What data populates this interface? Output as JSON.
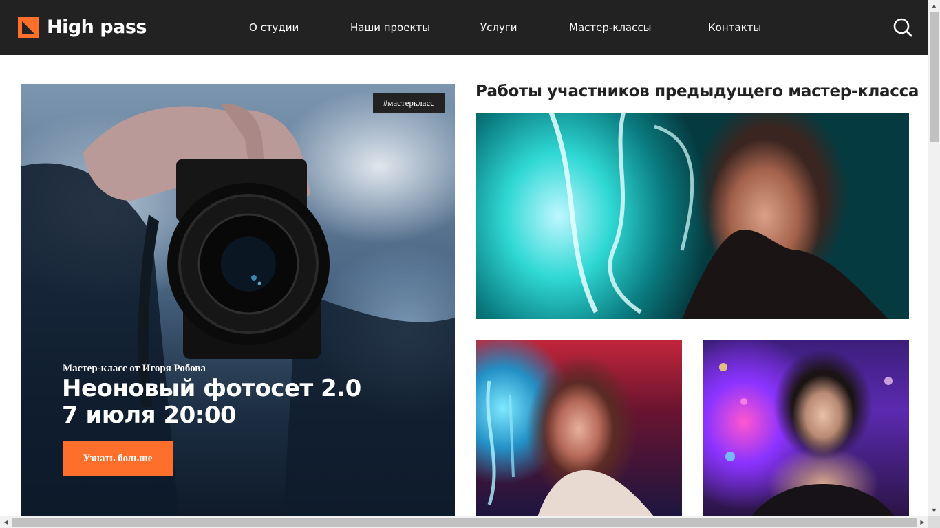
{
  "header": {
    "logo_text": "High pass",
    "nav": [
      {
        "label": "О студии"
      },
      {
        "label": "Наши проекты"
      },
      {
        "label": "Услуги"
      },
      {
        "label": "Мастер-классы"
      },
      {
        "label": "Контакты"
      }
    ],
    "search_icon": "search-icon"
  },
  "hero": {
    "tag": "#мастеркласс",
    "subtitle": "Мастер-класс от Игоря Робова",
    "title_line1": "Неоновый фотосет 2.0",
    "title_line2": "7 июля 20:00",
    "button_label": "Узнать больше"
  },
  "works": {
    "title": "Работы участников предыдущего мастер-класса"
  },
  "colors": {
    "accent": "#ff6f2c",
    "header_bg": "#222222",
    "text_dark": "#222222"
  }
}
